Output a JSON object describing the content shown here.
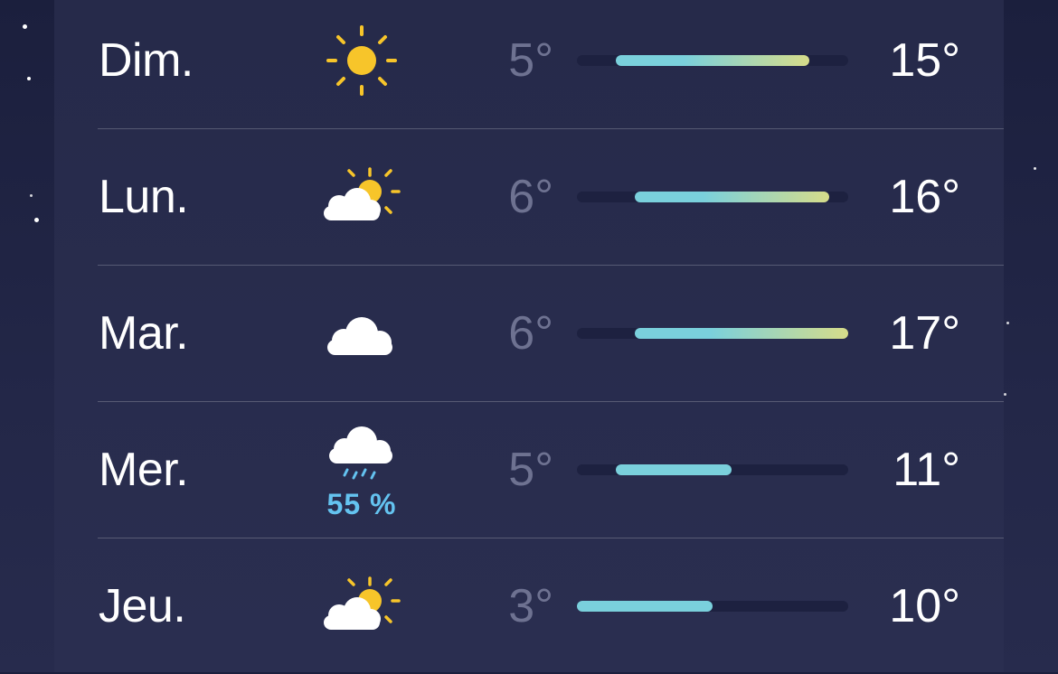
{
  "forecast": {
    "scale": {
      "min": 3,
      "max": 17
    },
    "days": [
      {
        "day": "Dim.",
        "icon": "sun-icon",
        "low": "5°",
        "high": "15°",
        "low_value": 5,
        "high_value": 15,
        "precip": ""
      },
      {
        "day": "Lun.",
        "icon": "partly-cloudy-icon",
        "low": "6°",
        "high": "16°",
        "low_value": 6,
        "high_value": 16,
        "precip": ""
      },
      {
        "day": "Mar.",
        "icon": "cloud-icon",
        "low": "6°",
        "high": "17°",
        "low_value": 6,
        "high_value": 17,
        "precip": ""
      },
      {
        "day": "Mer.",
        "icon": "rain-cloud-icon",
        "low": "5°",
        "high": "11°",
        "low_value": 5,
        "high_value": 11,
        "precip": "55 %"
      },
      {
        "day": "Jeu.",
        "icon": "partly-cloudy-icon",
        "low": "3°",
        "high": "10°",
        "low_value": 3,
        "high_value": 10,
        "precip": ""
      }
    ]
  },
  "colors": {
    "bar_cool": "#7ad0dc",
    "bar_warm": "#d6dc8a",
    "precip": "#64c3f0",
    "sun": "#f7c52a"
  }
}
